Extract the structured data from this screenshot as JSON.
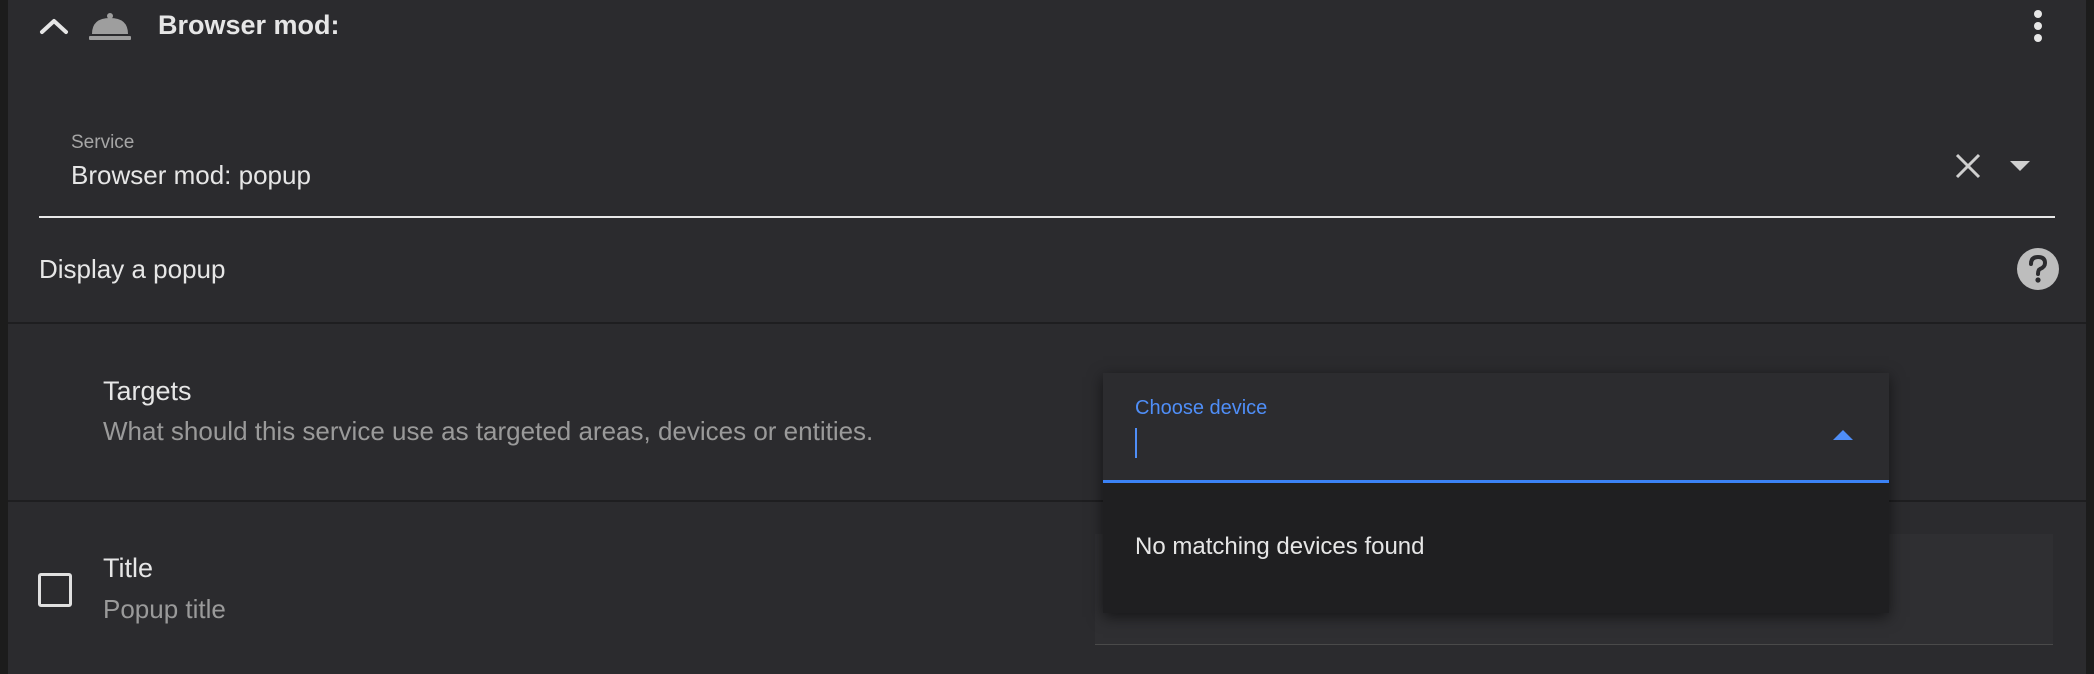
{
  "header": {
    "title": "Browser mod:",
    "collapse_icon": "chevron-up-icon",
    "domain_icon": "room-service-icon",
    "menu_icon": "dots-vertical-icon"
  },
  "service": {
    "label": "Service",
    "value": "Browser mod: popup",
    "clear_icon": "close-icon",
    "dropdown_icon": "menu-down-icon"
  },
  "description": {
    "text": "Display a popup",
    "help_icon": "help-circle-icon"
  },
  "targets": {
    "title": "Targets",
    "description": "What should this service use as targeted areas, devices or entities."
  },
  "device_picker": {
    "label": "Choose device",
    "value": "",
    "arrow_icon": "menu-up-icon",
    "empty_message": "No matching devices found"
  },
  "fields": {
    "title": {
      "label": "Title",
      "description": "Popup title",
      "checked": false
    }
  },
  "colors": {
    "accent": "#3b82f6",
    "background": "#2b2b2e"
  }
}
